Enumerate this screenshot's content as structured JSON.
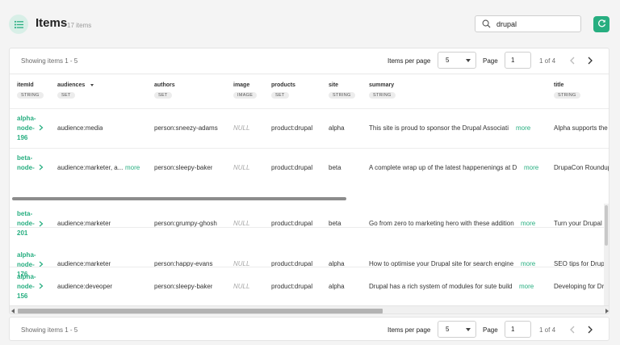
{
  "header": {
    "title": "Items",
    "count": "17 items",
    "search_value": "drupal"
  },
  "pager": {
    "showing": "Showing items 1 - 5",
    "items_per_page_label": "Items per page",
    "items_per_page_value": "5",
    "page_label": "Page",
    "page_value": "1",
    "of_pages": "1 of 4"
  },
  "columns": [
    {
      "name": "itemId",
      "type": "STRING"
    },
    {
      "name": "audiences",
      "type": "SET"
    },
    {
      "name": "authors",
      "type": "SET"
    },
    {
      "name": "image",
      "type": "IMAGE"
    },
    {
      "name": "products",
      "type": "SET"
    },
    {
      "name": "site",
      "type": "STRING"
    },
    {
      "name": "summary",
      "type": "STRING"
    },
    {
      "name": "title",
      "type": "STRING"
    }
  ],
  "rows": [
    {
      "id1": "alpha-",
      "id2": "node-",
      "id3": "196",
      "audiences": "audience:media",
      "audiences_more": "",
      "authors": "person:sneezy-adams",
      "image": "NULL",
      "products": "product:drupal",
      "site": "alpha",
      "summary": "This site is proud to sponsor the Drupal Associati",
      "summary_more": "more",
      "title": "Alpha supports the I"
    },
    {
      "id1": "beta-",
      "id2": "node-",
      "id3": "",
      "audiences": "audience:marketer, a...",
      "audiences_more": "more",
      "authors": "person:sleepy-baker",
      "image": "NULL",
      "products": "product:drupal",
      "site": "beta",
      "summary": "A complete wrap up of the latest happenenings at D",
      "summary_more": "more",
      "title": "DrupaCon Roundup"
    },
    {
      "id1": "beta-",
      "id2": "node-",
      "id3": "201",
      "audiences": "audience:marketer",
      "audiences_more": "",
      "authors": "person:grumpy-ghosh",
      "image": "NULL",
      "products": "product:drupal",
      "site": "beta",
      "summary": "Go from zero to marketing hero with these addition",
      "summary_more": "more",
      "title": "Turn your Drupal sit"
    },
    {
      "id1": "alpha-",
      "id2": "node-",
      "id3": "176",
      "audiences": "audience:marketer",
      "audiences_more": "",
      "authors": "person:happy-evans",
      "image": "NULL",
      "products": "product:drupal",
      "site": "alpha",
      "summary": "How to optimise your Drupal site for search engine",
      "summary_more": "more",
      "title": "SEO tips for Drupal"
    },
    {
      "id1": "alpha-",
      "id2": "node-",
      "id3": "156",
      "audiences": "audience:deveoper",
      "audiences_more": "",
      "authors": "person:sleepy-baker",
      "image": "NULL",
      "products": "product:drupal",
      "site": "alpha",
      "summary": "Drupal has a rich system of modules for sute build",
      "summary_more": "more",
      "title": "Developing for Drup"
    }
  ],
  "colors": {
    "accent": "#27ae80"
  },
  "icons": [
    "list-icon",
    "search-icon",
    "refresh-icon",
    "caret-down-icon",
    "chevron-left-icon",
    "chevron-right-icon"
  ]
}
